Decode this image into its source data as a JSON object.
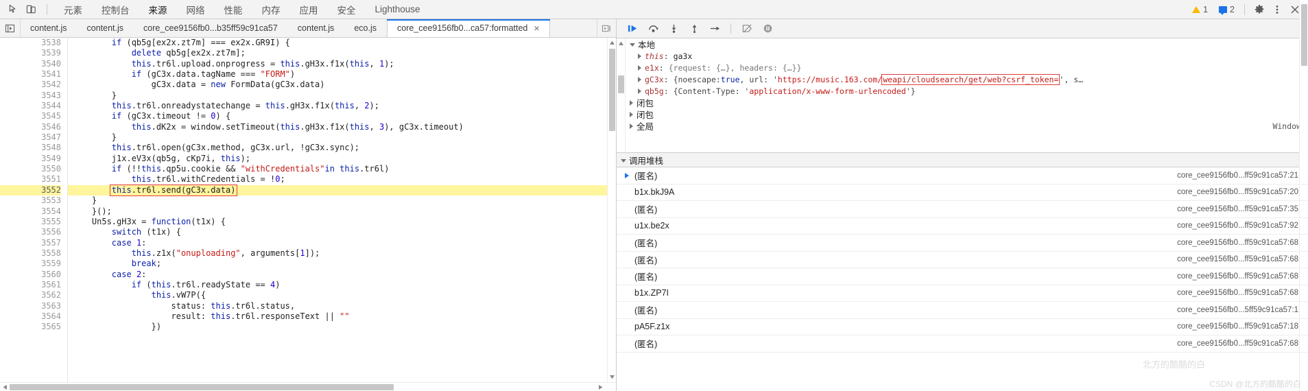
{
  "toolbar": {
    "inspect_icon": "cursor-inspect-icon",
    "device_icon": "device-toggle-icon",
    "panels": [
      {
        "label": "元素",
        "active": false
      },
      {
        "label": "控制台",
        "active": false
      },
      {
        "label": "来源",
        "active": true
      },
      {
        "label": "网络",
        "active": false
      },
      {
        "label": "性能",
        "active": false
      },
      {
        "label": "内存",
        "active": false
      },
      {
        "label": "应用",
        "active": false
      },
      {
        "label": "安全",
        "active": false
      },
      {
        "label": "Lighthouse",
        "active": false
      }
    ],
    "warning_count": "1",
    "message_count": "2",
    "settings_icon": "gear-icon",
    "more_icon": "kebab-menu-icon",
    "close_icon": "close-icon",
    "warning_color": "#fabb05",
    "message_color": "#1a73e8",
    "accent_color": "#1a73e8"
  },
  "file_tabs": {
    "nav_icon": "show-navigator-icon",
    "more_icon": "show-more-tabs-icon",
    "items": [
      {
        "label": "content.js",
        "active": false,
        "closable": false
      },
      {
        "label": "content.js",
        "active": false,
        "closable": false
      },
      {
        "label": "core_cee9156fb0...b35ff59c91ca57",
        "active": false,
        "closable": false
      },
      {
        "label": "content.js",
        "active": false,
        "closable": false
      },
      {
        "label": "eco.js",
        "active": false,
        "closable": false
      },
      {
        "label": "core_cee9156fb0...ca57:formatted",
        "active": true,
        "closable": true,
        "close_label": "×"
      }
    ]
  },
  "editor": {
    "first_line": 3538,
    "current_line": 3552,
    "highlight_color": "#fff59d",
    "box_outline_color": "#e23c3c",
    "lines": [
      {
        "n": 3538,
        "text": "        if (qb5g[ex2x.zt7m] === ex2x.GR9I) {"
      },
      {
        "n": 3539,
        "text": "            delete qb5g[ex2x.zt7m];"
      },
      {
        "n": 3540,
        "text": "            this.tr6l.upload.onprogress = this.gH3x.f1x(this, 1);"
      },
      {
        "n": 3541,
        "text": "            if (gC3x.data.tagName === \"FORM\")"
      },
      {
        "n": 3542,
        "text": "                gC3x.data = new FormData(gC3x.data)"
      },
      {
        "n": 3543,
        "text": "        }"
      },
      {
        "n": 3544,
        "text": "        this.tr6l.onreadystatechange = this.gH3x.f1x(this, 2);"
      },
      {
        "n": 3545,
        "text": "        if (gC3x.timeout != 0) {"
      },
      {
        "n": 3546,
        "text": "            this.dK2x = window.setTimeout(this.gH3x.f1x(this, 3), gC3x.timeout)"
      },
      {
        "n": 3547,
        "text": "        }"
      },
      {
        "n": 3548,
        "text": "        this.tr6l.open(gC3x.method, gC3x.url, !gC3x.sync);"
      },
      {
        "n": 3549,
        "text": "        j1x.eV3x(qb5g, cKp7i, this);"
      },
      {
        "n": 3550,
        "text": "        if (!!this.qp5u.cookie && \"withCredentials\"in this.tr6l)"
      },
      {
        "n": 3551,
        "text": "            this.tr6l.withCredentials = !0;"
      },
      {
        "n": 3552,
        "text": "        this.tr6l.send(gC3x.data)"
      },
      {
        "n": 3553,
        "text": "    }"
      },
      {
        "n": 3554,
        "text": "    }();"
      },
      {
        "n": 3555,
        "text": "    Un5s.gH3x = function(t1x) {"
      },
      {
        "n": 3556,
        "text": "        switch (t1x) {"
      },
      {
        "n": 3557,
        "text": "        case 1:"
      },
      {
        "n": 3558,
        "text": "            this.z1x(\"onuploading\", arguments[1]);"
      },
      {
        "n": 3559,
        "text": "            break;"
      },
      {
        "n": 3560,
        "text": "        case 2:"
      },
      {
        "n": 3561,
        "text": "            if (this.tr6l.readyState == 4)"
      },
      {
        "n": 3562,
        "text": "                this.vW7P({"
      },
      {
        "n": 3563,
        "text": "                    status: this.tr6l.status,"
      },
      {
        "n": 3564,
        "text": "                    result: this.tr6l.responseText || \"\""
      },
      {
        "n": 3565,
        "text": "                })"
      }
    ]
  },
  "debugger_toolbar": {
    "buttons": [
      {
        "name": "resume-script-execution-icon"
      },
      {
        "name": "step-over-next-function-call-icon"
      },
      {
        "name": "step-into-next-function-call-icon"
      },
      {
        "name": "step-out-of-current-function-icon"
      },
      {
        "name": "step-icon"
      },
      {
        "name": "deactivate-breakpoints-icon"
      },
      {
        "name": "pause-on-exceptions-icon"
      }
    ]
  },
  "scope": {
    "sections": [
      {
        "id": "local",
        "label": "本地",
        "expanded": true
      },
      {
        "id": "closure1",
        "label": "闭包",
        "expanded": false
      },
      {
        "id": "closure2",
        "label": "闭包",
        "expanded": false
      },
      {
        "id": "global",
        "label": "全局",
        "expanded": false,
        "value": "Window"
      }
    ],
    "local_vars": [
      {
        "name": "this",
        "italic": true,
        "value": "ga3x",
        "type": "plain"
      },
      {
        "name": "e1x",
        "italic": false,
        "value": "{request: {…}, headers: {…}}",
        "type": "object"
      },
      {
        "name": "gC3x",
        "italic": false,
        "value_prefix": "{noescape: ",
        "value_bool": "true",
        "value_mid": ", url: '",
        "value_url_head": "https://music.163.com/",
        "value_url_box": "weapi/cloudsearch/get/web?csrf_token=",
        "value_tail": "', s…",
        "type": "highlighted"
      },
      {
        "name": "qb5g",
        "italic": false,
        "value_prefix": "{Content-Type: '",
        "value_str": "application/x-www-form-urlencoded",
        "value_tail": "'}",
        "type": "string-object"
      }
    ]
  },
  "callstack": {
    "header": "调用堆栈",
    "rows": [
      {
        "name": "(匿名)",
        "location": "core_cee9156fb0...ff59c91ca57:21",
        "selected": true
      },
      {
        "name": "b1x.bkJ9A",
        "location": "core_cee9156fb0...ff59c91ca57:20",
        "selected": false
      },
      {
        "name": "(匿名)",
        "location": "core_cee9156fb0...ff59c91ca57:35",
        "selected": false
      },
      {
        "name": "u1x.be2x",
        "location": "core_cee9156fb0...ff59c91ca57:92",
        "selected": false
      },
      {
        "name": "(匿名)",
        "location": "core_cee9156fb0...ff59c91ca57:68",
        "selected": false
      },
      {
        "name": "(匿名)",
        "location": "core_cee9156fb0...ff59c91ca57:68",
        "selected": false
      },
      {
        "name": "(匿名)",
        "location": "core_cee9156fb0...ff59c91ca57:68",
        "selected": false
      },
      {
        "name": "b1x.ZP7I",
        "location": "core_cee9156fb0...ff59c91ca57:68",
        "selected": false
      },
      {
        "name": "(匿名)",
        "location": "core_cee9156fb0...5ff59c91ca57:1",
        "selected": false
      },
      {
        "name": "pA5F.z1x",
        "location": "core_cee9156fb0...ff59c91ca57:18",
        "selected": false
      },
      {
        "name": "(匿名)",
        "location": "core_cee9156fb0...ff59c91ca57:68",
        "selected": false
      }
    ]
  },
  "watermarks": {
    "bottom_right": "CSDN @北方的酷酷的白",
    "mid_right": "北方的酷酷的白"
  }
}
